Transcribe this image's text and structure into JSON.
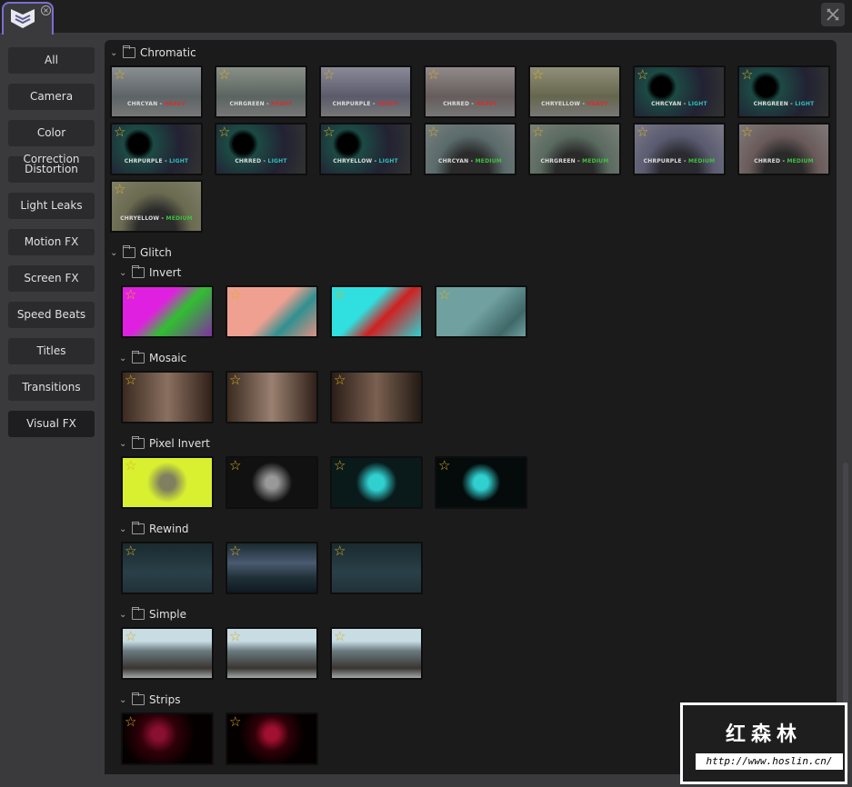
{
  "window": {
    "tab_close": "×",
    "tools_icon": "tools-icon"
  },
  "sidebar": {
    "items": [
      {
        "label": "All"
      },
      {
        "label": "Camera"
      },
      {
        "label": "Color Correction"
      },
      {
        "label": "Distortion"
      },
      {
        "label": "Light Leaks"
      },
      {
        "label": "Motion FX"
      },
      {
        "label": "Screen FX"
      },
      {
        "label": "Speed Beats"
      },
      {
        "label": "Titles"
      },
      {
        "label": "Transitions"
      },
      {
        "label": "Visual FX",
        "selected": true
      }
    ]
  },
  "content": {
    "groups": [
      {
        "name": "Chromatic",
        "items": [
          {
            "label": "CHRCYAN - ",
            "tag": "HEAVY",
            "tagc": "#d03030",
            "bg": "linear-gradient(180deg,#8a8f92,#5d6466 60%,#777)"
          },
          {
            "label": "CHRGREEN - ",
            "tag": "HEAVY",
            "tagc": "#d03030",
            "bg": "linear-gradient(180deg,#8a9088,#5a6460 60%,#777)"
          },
          {
            "label": "CHRPURPLE - ",
            "tag": "HEAVY",
            "tagc": "#d03030",
            "bg": "linear-gradient(180deg,#8a8a98,#5a5a6a 60%,#777)"
          },
          {
            "label": "CHRRED - ",
            "tag": "HEAVY",
            "tagc": "#d03030",
            "bg": "linear-gradient(180deg,#928a8a,#665c5c 60%,#777)"
          },
          {
            "label": "CHRYELLOW - ",
            "tag": "HEAVY",
            "tagc": "#d03030",
            "bg": "linear-gradient(180deg,#90907a,#66664e 60%,#777)"
          },
          {
            "label": "CHRCYAN - ",
            "tag": "LIGHT",
            "tagc": "#30c0c0",
            "bg": "radial-gradient(circle at 30% 40%,#000 14%,#1c4a44 22%,#223 60%,#333)"
          },
          {
            "label": "CHRGREEN - ",
            "tag": "LIGHT",
            "tagc": "#30c0c0",
            "bg": "radial-gradient(circle at 30% 40%,#000 14%,#1c4a44 22%,#223 60%,#333)"
          },
          {
            "label": "CHRPURPLE - ",
            "tag": "LIGHT",
            "tagc": "#30c0c0",
            "bg": "radial-gradient(circle at 30% 40%,#000 14%,#1c4a44 22%,#223 60%,#333)"
          },
          {
            "label": "CHRRED - ",
            "tag": "LIGHT",
            "tagc": "#30c0c0",
            "bg": "radial-gradient(circle at 30% 40%,#000 14%,#1c4a44 22%,#223 60%,#333)"
          },
          {
            "label": "CHRYELLOW - ",
            "tag": "LIGHT",
            "tagc": "#30c0c0",
            "bg": "radial-gradient(circle at 30% 40%,#000 14%,#1c4a44 22%,#223 60%,#333)"
          },
          {
            "label": "CHRCYAN - ",
            "tag": "MEDIUM",
            "tagc": "#40c040",
            "bg": "radial-gradient(ellipse at 50% 100%,#2a2a2a 30%,#5a6a6a 55%,#7a8080)"
          },
          {
            "label": "CHRGREEN - ",
            "tag": "MEDIUM",
            "tagc": "#40c040",
            "bg": "radial-gradient(ellipse at 50% 100%,#2a2a2a 30%,#5a6a60 55%,#7a8078)"
          },
          {
            "label": "CHRPURPLE - ",
            "tag": "MEDIUM",
            "tagc": "#40c040",
            "bg": "radial-gradient(ellipse at 50% 100%,#2a2a30 30%,#5a5a70 55%,#7a7a88)"
          },
          {
            "label": "CHRRED - ",
            "tag": "MEDIUM",
            "tagc": "#40c040",
            "bg": "radial-gradient(ellipse at 50% 100%,#2a2a2a 30%,#6a5a5a 55%,#807a7a)"
          },
          {
            "label": "CHRYELLOW - ",
            "tag": "MEDIUM",
            "tagc": "#40c040",
            "bg": "radial-gradient(ellipse at 50% 100%,#2a2a2a 30%,#6a6a50 55%,#80806a)"
          }
        ]
      },
      {
        "name": "Glitch",
        "subgroups": [
          {
            "name": "Invert",
            "items": [
              {
                "bg": "linear-gradient(135deg,#e020e0 40%,#30c030 60%,#8030a0)"
              },
              {
                "bg": "linear-gradient(135deg,#f0a090 50%,#309090 70%,#e09080)"
              },
              {
                "bg": "linear-gradient(135deg,#30e0e0 40%,#d02020 60%,#30d0d0)"
              },
              {
                "bg": "linear-gradient(135deg,#70a0a0 50%,#406868 80%,#70a0a0)"
              }
            ]
          },
          {
            "name": "Mosaic",
            "items": [
              {
                "bg": "linear-gradient(90deg,#3a2a20,#8a7060 50%,#302018)"
              },
              {
                "bg": "linear-gradient(90deg,#3a2a20,#9a8070 50%,#302018)"
              },
              {
                "bg": "linear-gradient(90deg,#2a1e18,#7a6050 50%,#221a14)"
              }
            ]
          },
          {
            "name": "Pixel Invert",
            "items": [
              {
                "bg": "radial-gradient(circle at 50% 50%,#808060 15%,#d8f030 40%)"
              },
              {
                "bg": "radial-gradient(circle at 50% 50%,#999 12%,#111 40%)"
              },
              {
                "bg": "radial-gradient(circle at 50% 50%,#30d0d0 15%,#0a1a1a 40%)"
              },
              {
                "bg": "radial-gradient(circle at 50% 50%,#30d0d0 14%,#050a0a 38%)"
              }
            ]
          },
          {
            "name": "Rewind",
            "items": [
              {
                "bg": "linear-gradient(180deg,#1a2a30,#2a4048 60%,#203038)"
              },
              {
                "bg": "linear-gradient(180deg,#1a2a30,#4a5a70 40%,#203038 70%,#101820)"
              },
              {
                "bg": "linear-gradient(180deg,#1a2a30,#2a4048 60%,#203038)"
              }
            ]
          },
          {
            "name": "Simple",
            "items": [
              {
                "bg": "linear-gradient(180deg,#c8dce4 25%,#6a7a80 45%,#3a3530 80%,#a0a8a8)"
              },
              {
                "bg": "linear-gradient(180deg,#c8dce4 25%,#6a7a80 45%,#3a3530 80%,#a0a8a8)"
              },
              {
                "bg": "linear-gradient(180deg,#c8dce4 25%,#6a7a80 45%,#3a3530 80%,#a0a8a8)"
              }
            ]
          },
          {
            "name": "Strips",
            "items": [
              {
                "bg": "radial-gradient(circle at 40% 40%,#8a1030 10%,#300008 30%,#050000 60%)"
              },
              {
                "bg": "radial-gradient(circle at 50% 40%,#a01030 12%,#300008 32%,#050000 60%)"
              }
            ]
          },
          {
            "name": "",
            "items": []
          }
        ]
      }
    ]
  },
  "watermark": {
    "title": "红森林",
    "url": "http://www.hoslin.cn/"
  }
}
